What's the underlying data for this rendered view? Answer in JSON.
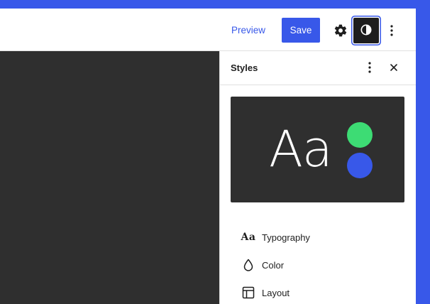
{
  "topbar": {
    "preview_label": "Preview",
    "save_label": "Save",
    "icons": {
      "settings": "gear-icon",
      "styles": "half-circle-contrast-icon",
      "options": "vertical-ellipsis-icon"
    }
  },
  "sidebar": {
    "title": "Styles",
    "icons": {
      "more": "vertical-ellipsis-icon",
      "close": "close-icon"
    },
    "preview": {
      "sample_text": "Aa",
      "colors": [
        "#3ddc74",
        "#3858e9"
      ],
      "background": "#2f2f2f"
    },
    "items": [
      {
        "label": "Typography",
        "icon_text": "Aa",
        "icon": "typography-icon"
      },
      {
        "label": "Color",
        "icon": "droplet-icon"
      },
      {
        "label": "Layout",
        "icon": "layout-icon"
      }
    ]
  },
  "colors": {
    "accent": "#3858e9",
    "canvas": "#2f2f2f",
    "frame_border": "#3858e9"
  }
}
